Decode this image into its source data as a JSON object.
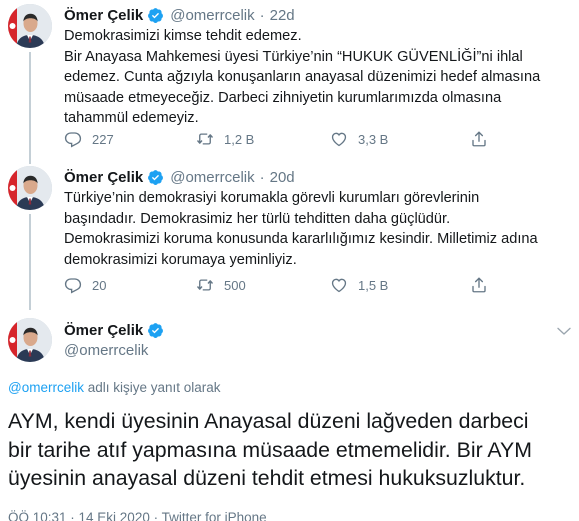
{
  "tweets": [
    {
      "name": "Ömer Çelik",
      "handle": "@omerrcelik",
      "dot": "·",
      "time": "22d",
      "lines": [
        "Demokrasimizi kimse tehdit edemez.",
        "Bir Anayasa Mahkemesi üyesi Türkiye’nin “HUKUK GÜVENLİĞİ”ni ihlal",
        "edemez. Cunta ağzıyla konuşanların anayasal düzenimizi hedef almasına",
        "müsaade etmeyeceğiz. Darbeci zihniyetin kurumlarımızda olmasına",
        "tahammül edemeyiz."
      ],
      "replies": "227",
      "retweets": "1,2 B",
      "likes": "3,3 B"
    },
    {
      "name": "Ömer Çelik",
      "handle": "@omerrcelik",
      "dot": "·",
      "time": "20d",
      "lines": [
        "Türkiye’nin demokrasiyi korumakla görevli kurumları görevlerinin",
        "başındadır. Demokrasimiz her türlü tehditten daha güçlüdür.",
        "Demokrasimizi koruma konusunda kararlılığımız kesindir. Milletimiz adına",
        "demokrasimizi korumaya yeminliyiz."
      ],
      "replies": "20",
      "retweets": "500",
      "likes": "1,5 B"
    }
  ],
  "main": {
    "name": "Ömer Çelik",
    "handle": "@omerrcelik",
    "reply_handle": "@omerrcelik",
    "reply_suffix": " adlı kişiye yanıt olarak",
    "lines": [
      "AYM, kendi üyesinin Anayasal düzeni lağveden darbeci",
      "bir tarihe atıf yapmasına müsaade etmemelidir. Bir AYM",
      "üyesinin anayasal düzeni tehdit etmesi hukuksuzluktur."
    ],
    "meta": "ÖÖ 10:31 · 14 Eki 2020 · Twitter for iPhone"
  },
  "icons": {
    "reply": "reply-icon",
    "retweet": "retweet-icon",
    "like": "heart-icon",
    "share": "share-icon",
    "verified": "verified-badge-icon",
    "more": "chevron-down-icon"
  },
  "colors": {
    "accent": "#1da1f2",
    "text": "#14171a",
    "secondary": "#657786",
    "divider": "#e6ecf0"
  }
}
